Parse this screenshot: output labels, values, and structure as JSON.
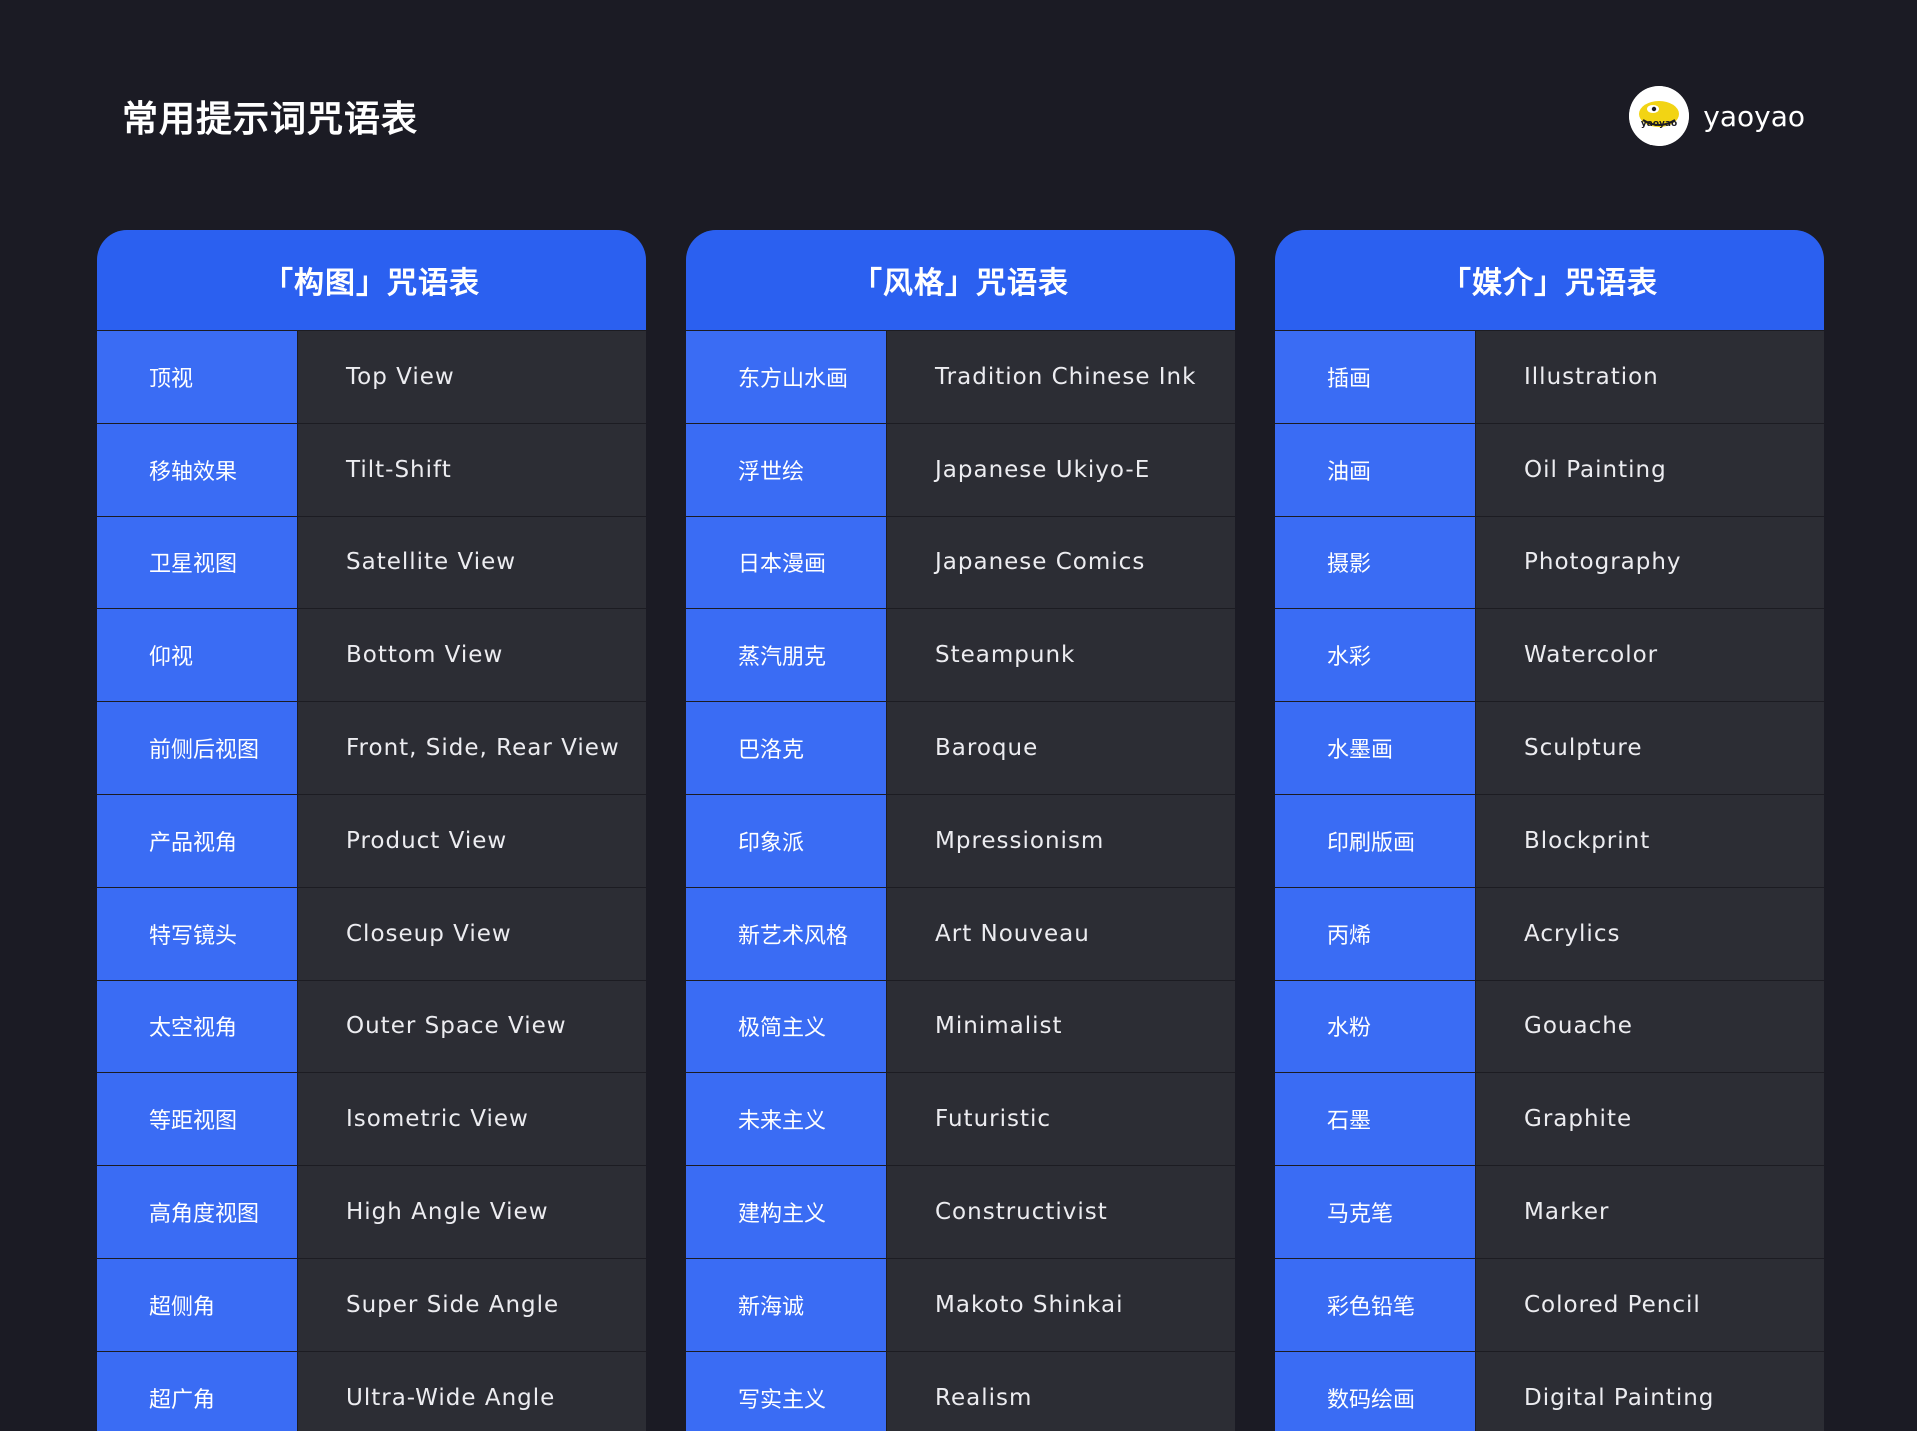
{
  "page": {
    "title": "常用提示词咒语表",
    "brand_name": "yaoyao",
    "brand_logo_text": "yaoyao",
    "colors": {
      "background": "#1b1b24",
      "accent": "#2b60f0",
      "cell_blue": "#3a6cf4",
      "cell_dark": "#2c2d34"
    }
  },
  "tables": [
    {
      "title": "「构图」咒语表",
      "rows": [
        {
          "zh": "顶视",
          "en": "Top View"
        },
        {
          "zh": "移轴效果",
          "en": "Tilt-Shift"
        },
        {
          "zh": "卫星视图",
          "en": "Satellite View"
        },
        {
          "zh": "仰视",
          "en": "Bottom View"
        },
        {
          "zh": "前侧后视图",
          "en": "Front, Side, Rear View"
        },
        {
          "zh": "产品视角",
          "en": "Product View"
        },
        {
          "zh": "特写镜头",
          "en": "Closeup View"
        },
        {
          "zh": "太空视角",
          "en": "Outer Space View"
        },
        {
          "zh": "等距视图",
          "en": "Isometric View"
        },
        {
          "zh": "高角度视图",
          "en": "High Angle View"
        },
        {
          "zh": "超侧角",
          "en": "Super Side Angle"
        },
        {
          "zh": "超广角",
          "en": "Ultra-Wide Angle"
        }
      ]
    },
    {
      "title": "「风格」咒语表",
      "rows": [
        {
          "zh": "东方山水画",
          "en": "Tradition Chinese Ink"
        },
        {
          "zh": "浮世绘",
          "en": "Japanese Ukiyo-E"
        },
        {
          "zh": "日本漫画",
          "en": "Japanese Comics"
        },
        {
          "zh": "蒸汽朋克",
          "en": "Steampunk"
        },
        {
          "zh": "巴洛克",
          "en": "Baroque"
        },
        {
          "zh": "印象派",
          "en": "Mpressionism"
        },
        {
          "zh": "新艺术风格",
          "en": "Art Nouveau"
        },
        {
          "zh": "极简主义",
          "en": "Minimalist"
        },
        {
          "zh": "未来主义",
          "en": "Futuristic"
        },
        {
          "zh": "建构主义",
          "en": "Constructivist"
        },
        {
          "zh": "新海诚",
          "en": "Makoto Shinkai"
        },
        {
          "zh": "写实主义",
          "en": "Realism"
        }
      ]
    },
    {
      "title": "「媒介」咒语表",
      "rows": [
        {
          "zh": "插画",
          "en": "Illustration"
        },
        {
          "zh": "油画",
          "en": "Oil Painting"
        },
        {
          "zh": "摄影",
          "en": "Photography"
        },
        {
          "zh": "水彩",
          "en": "Watercolor"
        },
        {
          "zh": "水墨画",
          "en": "Sculpture"
        },
        {
          "zh": "印刷版画",
          "en": "Blockprint"
        },
        {
          "zh": "丙烯",
          "en": "Acrylics"
        },
        {
          "zh": "水粉",
          "en": "Gouache"
        },
        {
          "zh": "石墨",
          "en": "Graphite"
        },
        {
          "zh": "马克笔",
          "en": "Marker"
        },
        {
          "zh": "彩色铅笔",
          "en": "Colored Pencil"
        },
        {
          "zh": "数码绘画",
          "en": "Digital Painting"
        }
      ]
    }
  ]
}
